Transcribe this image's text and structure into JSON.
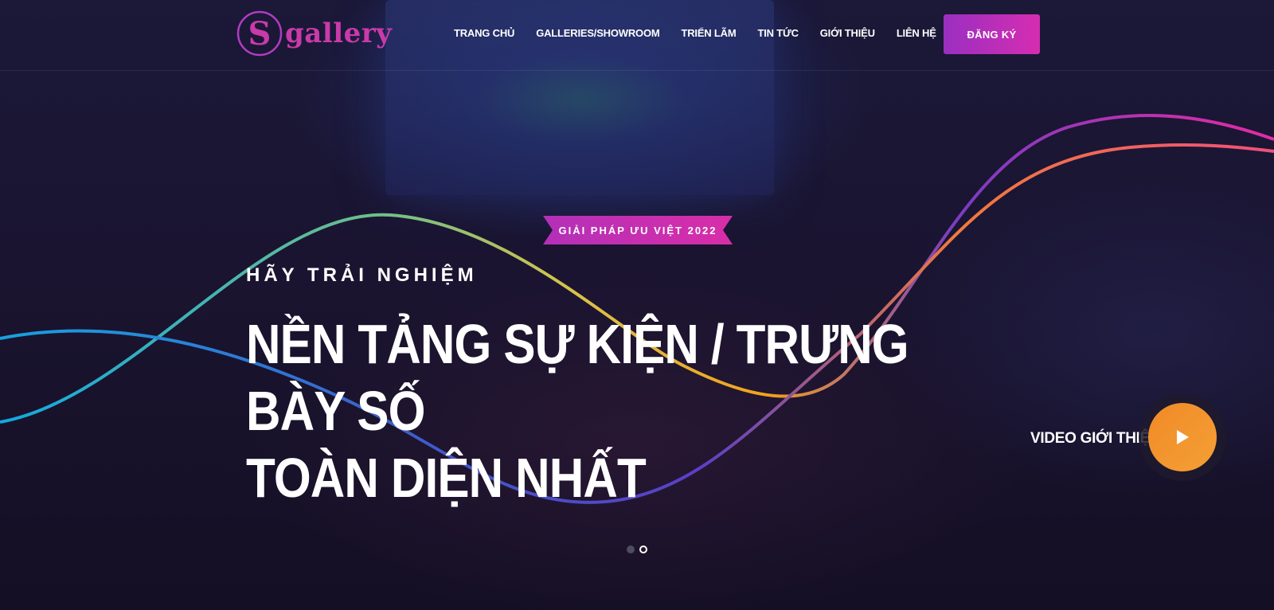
{
  "brand": {
    "logo_text": "gallery",
    "color": "#c93aa9"
  },
  "nav": {
    "items": [
      "TRANG CHỦ",
      "GALLERIES/SHOWROOM",
      "TRIỂN LÃM",
      "TIN TỨC",
      "GIỚI THIỆU",
      "LIÊN HỆ"
    ],
    "register_label": "ĐĂNG KÝ"
  },
  "hero": {
    "ribbon": "GIẢI PHÁP ƯU VIỆT 2022",
    "kicker": "HÃY TRẢI NGHIỆM",
    "headline_line1": "NỀN TẢNG SỰ KIỆN / TRƯNG BÀY SỐ",
    "headline_line2": "TOÀN DIỆN NHẤT",
    "video_label": "VIDEO GIỚI THIỆU",
    "play_icon": "play-icon"
  },
  "slider": {
    "slides": 2,
    "active_index": 1
  },
  "colors": {
    "accent_purple": "#9a2fc1",
    "accent_pink": "#d52db1",
    "accent_orange": "#f18a27",
    "background": "#161130"
  }
}
